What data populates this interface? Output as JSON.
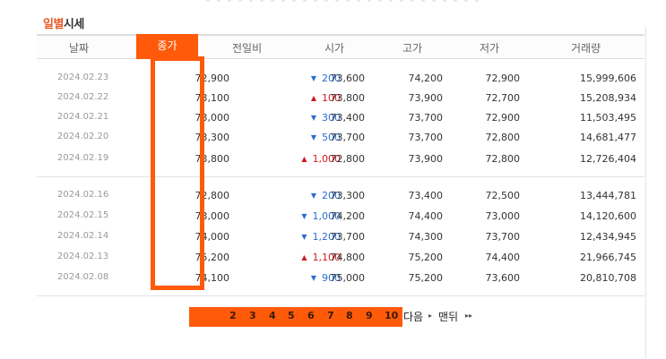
{
  "title": {
    "accent": "일별",
    "rest": "시세"
  },
  "columns": {
    "date": "날짜",
    "close": "종가",
    "change": "전일비",
    "open": "시가",
    "high": "고가",
    "low": "저가",
    "volume": "거래량"
  },
  "rows": [
    {
      "date": "2024.02.23",
      "close": "72,900",
      "dir": "down",
      "arrow": "▼",
      "change": "200",
      "open": "73,600",
      "high": "74,200",
      "low": "72,900",
      "volume": "15,999,606"
    },
    {
      "date": "2024.02.22",
      "close": "73,100",
      "dir": "up",
      "arrow": "▲",
      "change": "100",
      "open": "73,800",
      "high": "73,900",
      "low": "72,700",
      "volume": "15,208,934"
    },
    {
      "date": "2024.02.21",
      "close": "73,000",
      "dir": "down",
      "arrow": "▼",
      "change": "300",
      "open": "73,400",
      "high": "73,700",
      "low": "72,900",
      "volume": "11,503,495"
    },
    {
      "date": "2024.02.20",
      "close": "73,300",
      "dir": "down",
      "arrow": "▼",
      "change": "500",
      "open": "73,700",
      "high": "73,700",
      "low": "72,800",
      "volume": "14,681,477"
    },
    {
      "date": "2024.02.19",
      "close": "73,800",
      "dir": "up",
      "arrow": "▲",
      "change": "1,000",
      "open": "72,800",
      "high": "73,900",
      "low": "72,800",
      "volume": "12,726,404"
    },
    {
      "date": "2024.02.16",
      "close": "72,800",
      "dir": "down",
      "arrow": "▼",
      "change": "200",
      "open": "73,300",
      "high": "73,400",
      "low": "72,500",
      "volume": "13,444,781"
    },
    {
      "date": "2024.02.15",
      "close": "73,000",
      "dir": "down",
      "arrow": "▼",
      "change": "1,000",
      "open": "74,200",
      "high": "74,400",
      "low": "73,000",
      "volume": "14,120,600"
    },
    {
      "date": "2024.02.14",
      "close": "74,000",
      "dir": "down",
      "arrow": "▼",
      "change": "1,200",
      "open": "73,700",
      "high": "74,300",
      "low": "73,700",
      "volume": "12,434,945"
    },
    {
      "date": "2024.02.13",
      "close": "75,200",
      "dir": "up",
      "arrow": "▲",
      "change": "1,100",
      "open": "74,800",
      "high": "75,200",
      "low": "74,400",
      "volume": "21,966,745"
    },
    {
      "date": "2024.02.08",
      "close": "74,100",
      "dir": "down",
      "arrow": "▼",
      "change": "900",
      "open": "75,000",
      "high": "75,200",
      "low": "73,600",
      "volume": "20,810,708"
    }
  ],
  "pagination": {
    "pages": [
      "2",
      "3",
      "4",
      "5",
      "6",
      "7",
      "8",
      "9",
      "10"
    ],
    "next": "다음",
    "last": "맨뒤",
    "next_arrow": "▸",
    "last_arrow": "▸▸"
  },
  "colors": {
    "accent": "#ff5a0a",
    "up": "#d0181f",
    "down": "#2a6dd1"
  },
  "icons": {
    "up": "triangle-up-icon",
    "down": "triangle-down-icon",
    "next": "arrow-right-icon",
    "last": "double-arrow-right-icon"
  }
}
